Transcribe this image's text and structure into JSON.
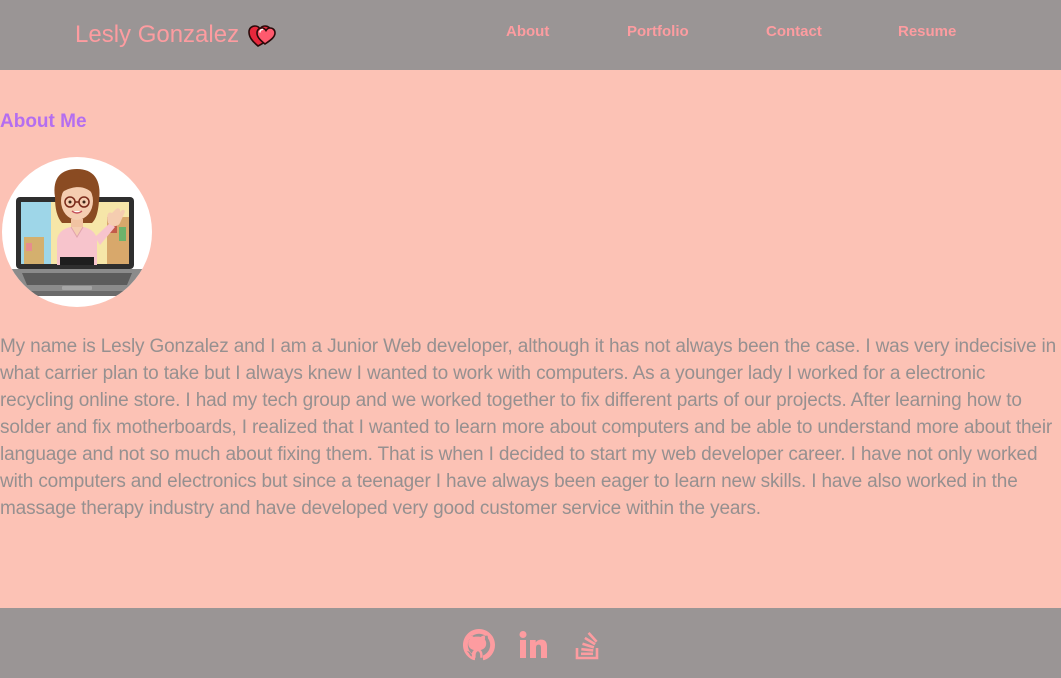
{
  "header": {
    "brand_name": "Lesly Gonzalez",
    "brand_icon": "double-heart-icon",
    "nav": {
      "about": "About",
      "portfolio": "Portfolio",
      "contact": "Contact",
      "resume": "Resume"
    }
  },
  "main": {
    "heading": "About Me",
    "avatar_icon": "bitmoji-avatar-with-laptop",
    "bio": "My name is Lesly Gonzalez and I am a Junior Web developer, although it has not always been the case. I was very indecisive in what carrier plan to take but I always knew I wanted to work with computers. As a younger lady I worked for a electronic recycling online store. I had my tech group and we worked together to fix different parts of our projects. After learning how to solder and fix motherboards, I realized that I wanted to learn more about computers and be able to understand more about their language and not so much about fixing them. That is when I decided to start my web developer career. I have not only worked with computers and electronics but since a teenager I have always been eager to learn new skills. I have also worked in the massage therapy industry and have developed very good customer service within the years."
  },
  "footer": {
    "social_icons": [
      "github-icon",
      "linkedin-icon",
      "stack-overflow-icon"
    ]
  },
  "colors": {
    "page_background": "#fcc2b5",
    "bar_background": "#9a9595",
    "accent_pink": "#fd9ca0",
    "heading_purple": "#b46ef0",
    "body_text": "#969090"
  }
}
